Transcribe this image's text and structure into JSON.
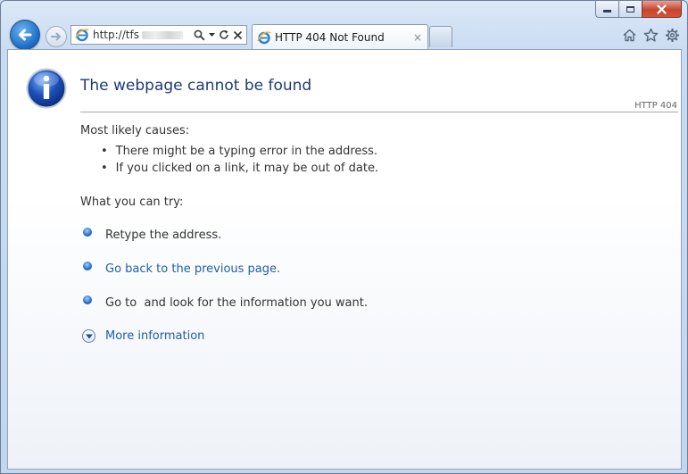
{
  "browser": {
    "address": {
      "url_prefix": "http://tfs"
    },
    "tab": {
      "title": "HTTP 404 Not Found",
      "close_glyph": "×"
    }
  },
  "page": {
    "title": "The webpage cannot be found",
    "status_code": "HTTP 404",
    "causes_heading": "Most likely causes:",
    "causes": [
      "There might be a typing error in the address.",
      "If you clicked on a link, it may be out of date."
    ],
    "try_heading": "What you can try:",
    "try_items": [
      {
        "text": "Retype the address."
      },
      {
        "text": "Go back to the previous page."
      },
      {
        "text": "Go to  and look for the information you want."
      }
    ],
    "more_info": "More information"
  },
  "icons": {
    "back": "back-arrow-icon",
    "forward": "forward-arrow-icon",
    "page": "internet-explorer-icon",
    "search": "search-icon",
    "dropdown": "chevron-down-icon",
    "refresh": "refresh-icon",
    "stop": "close-icon",
    "home": "home-icon",
    "favorites": "star-icon",
    "tools": "gear-icon",
    "info": "info-icon",
    "expand": "expand-icon"
  },
  "colors": {
    "title_blue": "#1f3b73",
    "link_blue": "#1f5ea8",
    "close_red": "#c8452f"
  }
}
